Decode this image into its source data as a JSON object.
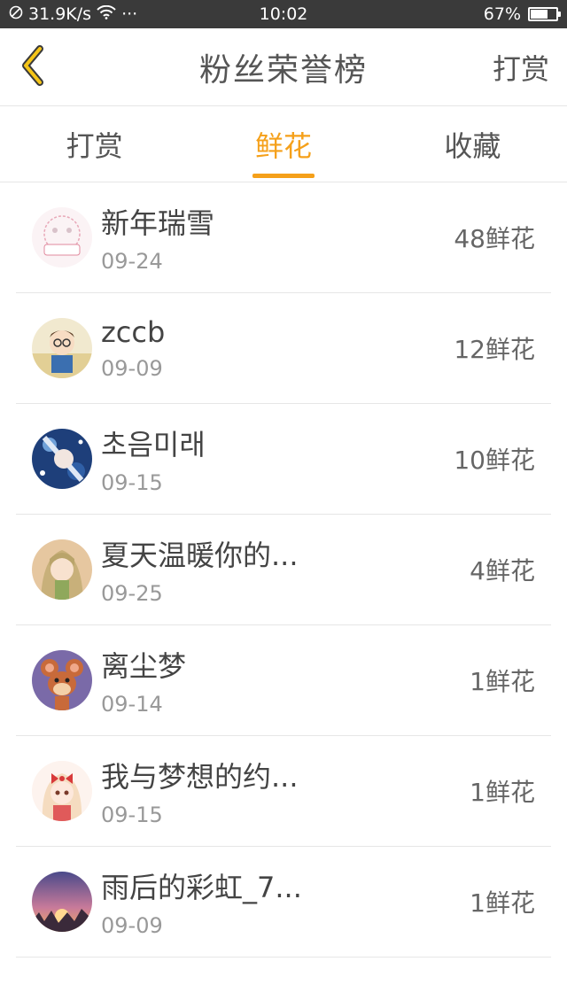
{
  "status_bar": {
    "speed": "31.9K/s",
    "dots": "···",
    "time": "10:02",
    "battery_text": "67%",
    "battery_level": 0.67
  },
  "header": {
    "title": "粉丝荣誉榜",
    "action_label": "打赏",
    "back_icon": "chevron-left-icon"
  },
  "tabs": [
    {
      "label": "打赏",
      "active": false
    },
    {
      "label": "鲜花",
      "active": true
    },
    {
      "label": "收藏",
      "active": false
    }
  ],
  "colors": {
    "accent": "#f5a01a",
    "status_bar_bg": "#3a3a3a",
    "divider": "#e6e6e6"
  },
  "ranking": [
    {
      "name": "新年瑞雪",
      "date": "09-24",
      "count": "48鲜花"
    },
    {
      "name": "zccb",
      "date": "09-09",
      "count": "12鲜花"
    },
    {
      "name": "초음미래",
      "date": "09-15",
      "count": "10鲜花"
    },
    {
      "name": "夏天温暖你的...",
      "date": "09-25",
      "count": "4鲜花"
    },
    {
      "name": "离尘梦",
      "date": "09-14",
      "count": "1鲜花"
    },
    {
      "name": "我与梦想的约...",
      "date": "09-15",
      "count": "1鲜花"
    },
    {
      "name": "雨后的彩虹_7...",
      "date": "09-09",
      "count": "1鲜花"
    }
  ]
}
